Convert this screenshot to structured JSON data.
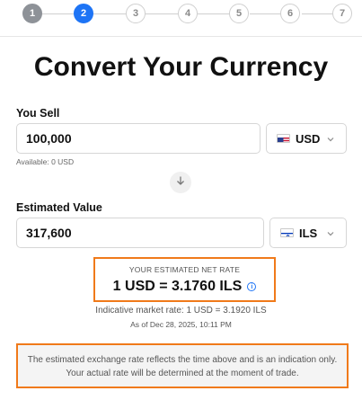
{
  "stepper": {
    "steps": [
      {
        "label": "1",
        "state": "done"
      },
      {
        "label": "2",
        "state": "active"
      },
      {
        "label": "3",
        "state": "upcoming"
      },
      {
        "label": "4",
        "state": "upcoming"
      },
      {
        "label": "5",
        "state": "upcoming"
      },
      {
        "label": "6",
        "state": "upcoming"
      },
      {
        "label": "7",
        "state": "upcoming"
      }
    ]
  },
  "page": {
    "title": "Convert Your Currency"
  },
  "sell": {
    "label": "You Sell",
    "amount": "100,000",
    "currency": {
      "code": "USD",
      "flag_icon": "us-flag-icon"
    },
    "available": "Available: 0 USD"
  },
  "estimate": {
    "label": "Estimated Value",
    "amount": "317,600",
    "currency": {
      "code": "ILS",
      "flag_icon": "israel-flag-icon"
    }
  },
  "rate": {
    "heading": "YOUR ESTIMATED NET RATE",
    "value": "1 USD = 3.1760 ILS",
    "info_icon": "info-icon",
    "market_rate": "Indicative market rate: 1 USD = 3.1920 ILS",
    "as_of": "As of Dec 28, 2025, 10:11 PM"
  },
  "disclaimer": {
    "line1": "The estimated exchange rate reflects the time above and is an indication only.",
    "line2": "Your actual rate will be determined at the moment of trade."
  },
  "colors": {
    "accent": "#1e74f5",
    "highlight_border": "#f07a1a",
    "completed_step": "#8e9298"
  }
}
